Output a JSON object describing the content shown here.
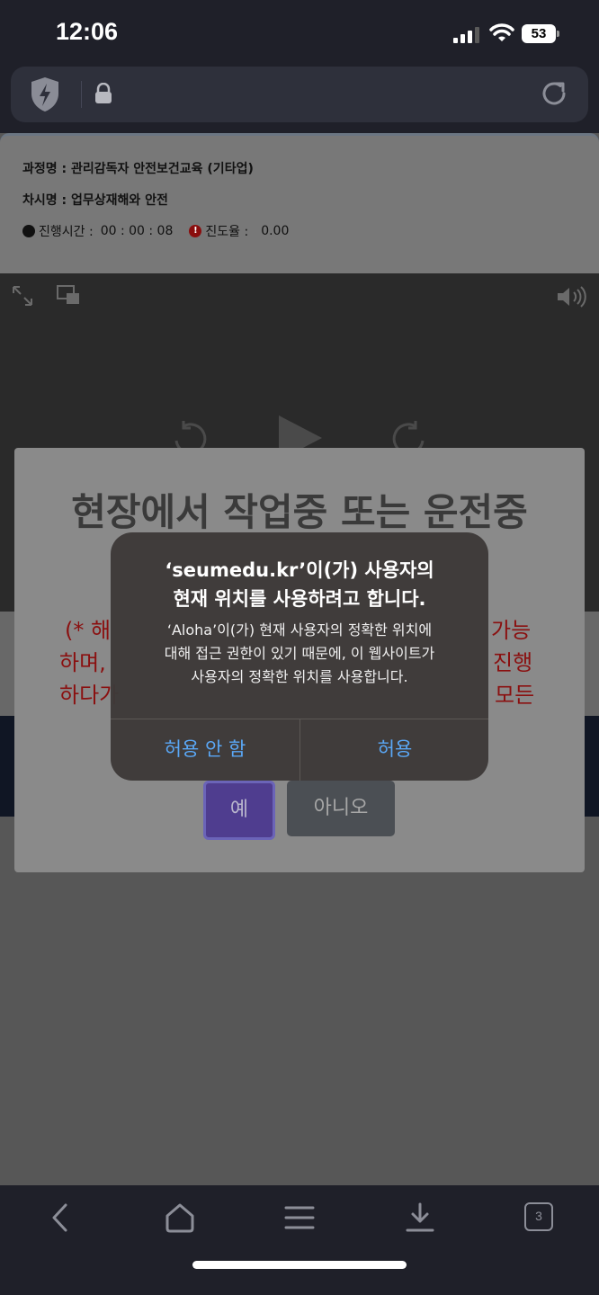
{
  "status_bar": {
    "time": "12:06",
    "battery": "53"
  },
  "course": {
    "course_line": "과정명 : 관리감독자 안전보건교육 (기타업)",
    "lesson_line": "차시명 : 업무상재해와 안전",
    "elapsed_label": "진행시간 :",
    "elapsed_value": "00 : 00 : 08",
    "progress_label": "진도율 :",
    "progress_value": "0.00",
    "alert_dot": "!"
  },
  "site_modal": {
    "title": "현장에서 작업중 또는 운전중",
    "red_left_1": "(* 해",
    "red_left_2": "하며,",
    "red_left_3": "하다가",
    "red_right_1": "가능",
    "red_right_2": "진행",
    "red_right_3": "모든",
    "yes_label": "예",
    "no_label": "아니오"
  },
  "location_alert": {
    "title_line1": "‘seumedu.kr’이(가) 사용자의",
    "title_line2": "현재 위치를 사용하려고 합니다.",
    "msg_line1": "‘Aloha’이(가) 현재 사용자의 정확한 위치에",
    "msg_line2": "대해 접근 권한이 있기 때문에, 이 웹사이트가",
    "msg_line3": "사용자의 정확한 위치를 사용합니다.",
    "deny_label": "허용 안 함",
    "allow_label": "허용"
  },
  "toolbar": {
    "tab_count": "3"
  },
  "colors": {
    "accent_blue": "#5aa7f5",
    "warning_red": "#8a1010",
    "yes_purple": "#4f3d8f"
  }
}
